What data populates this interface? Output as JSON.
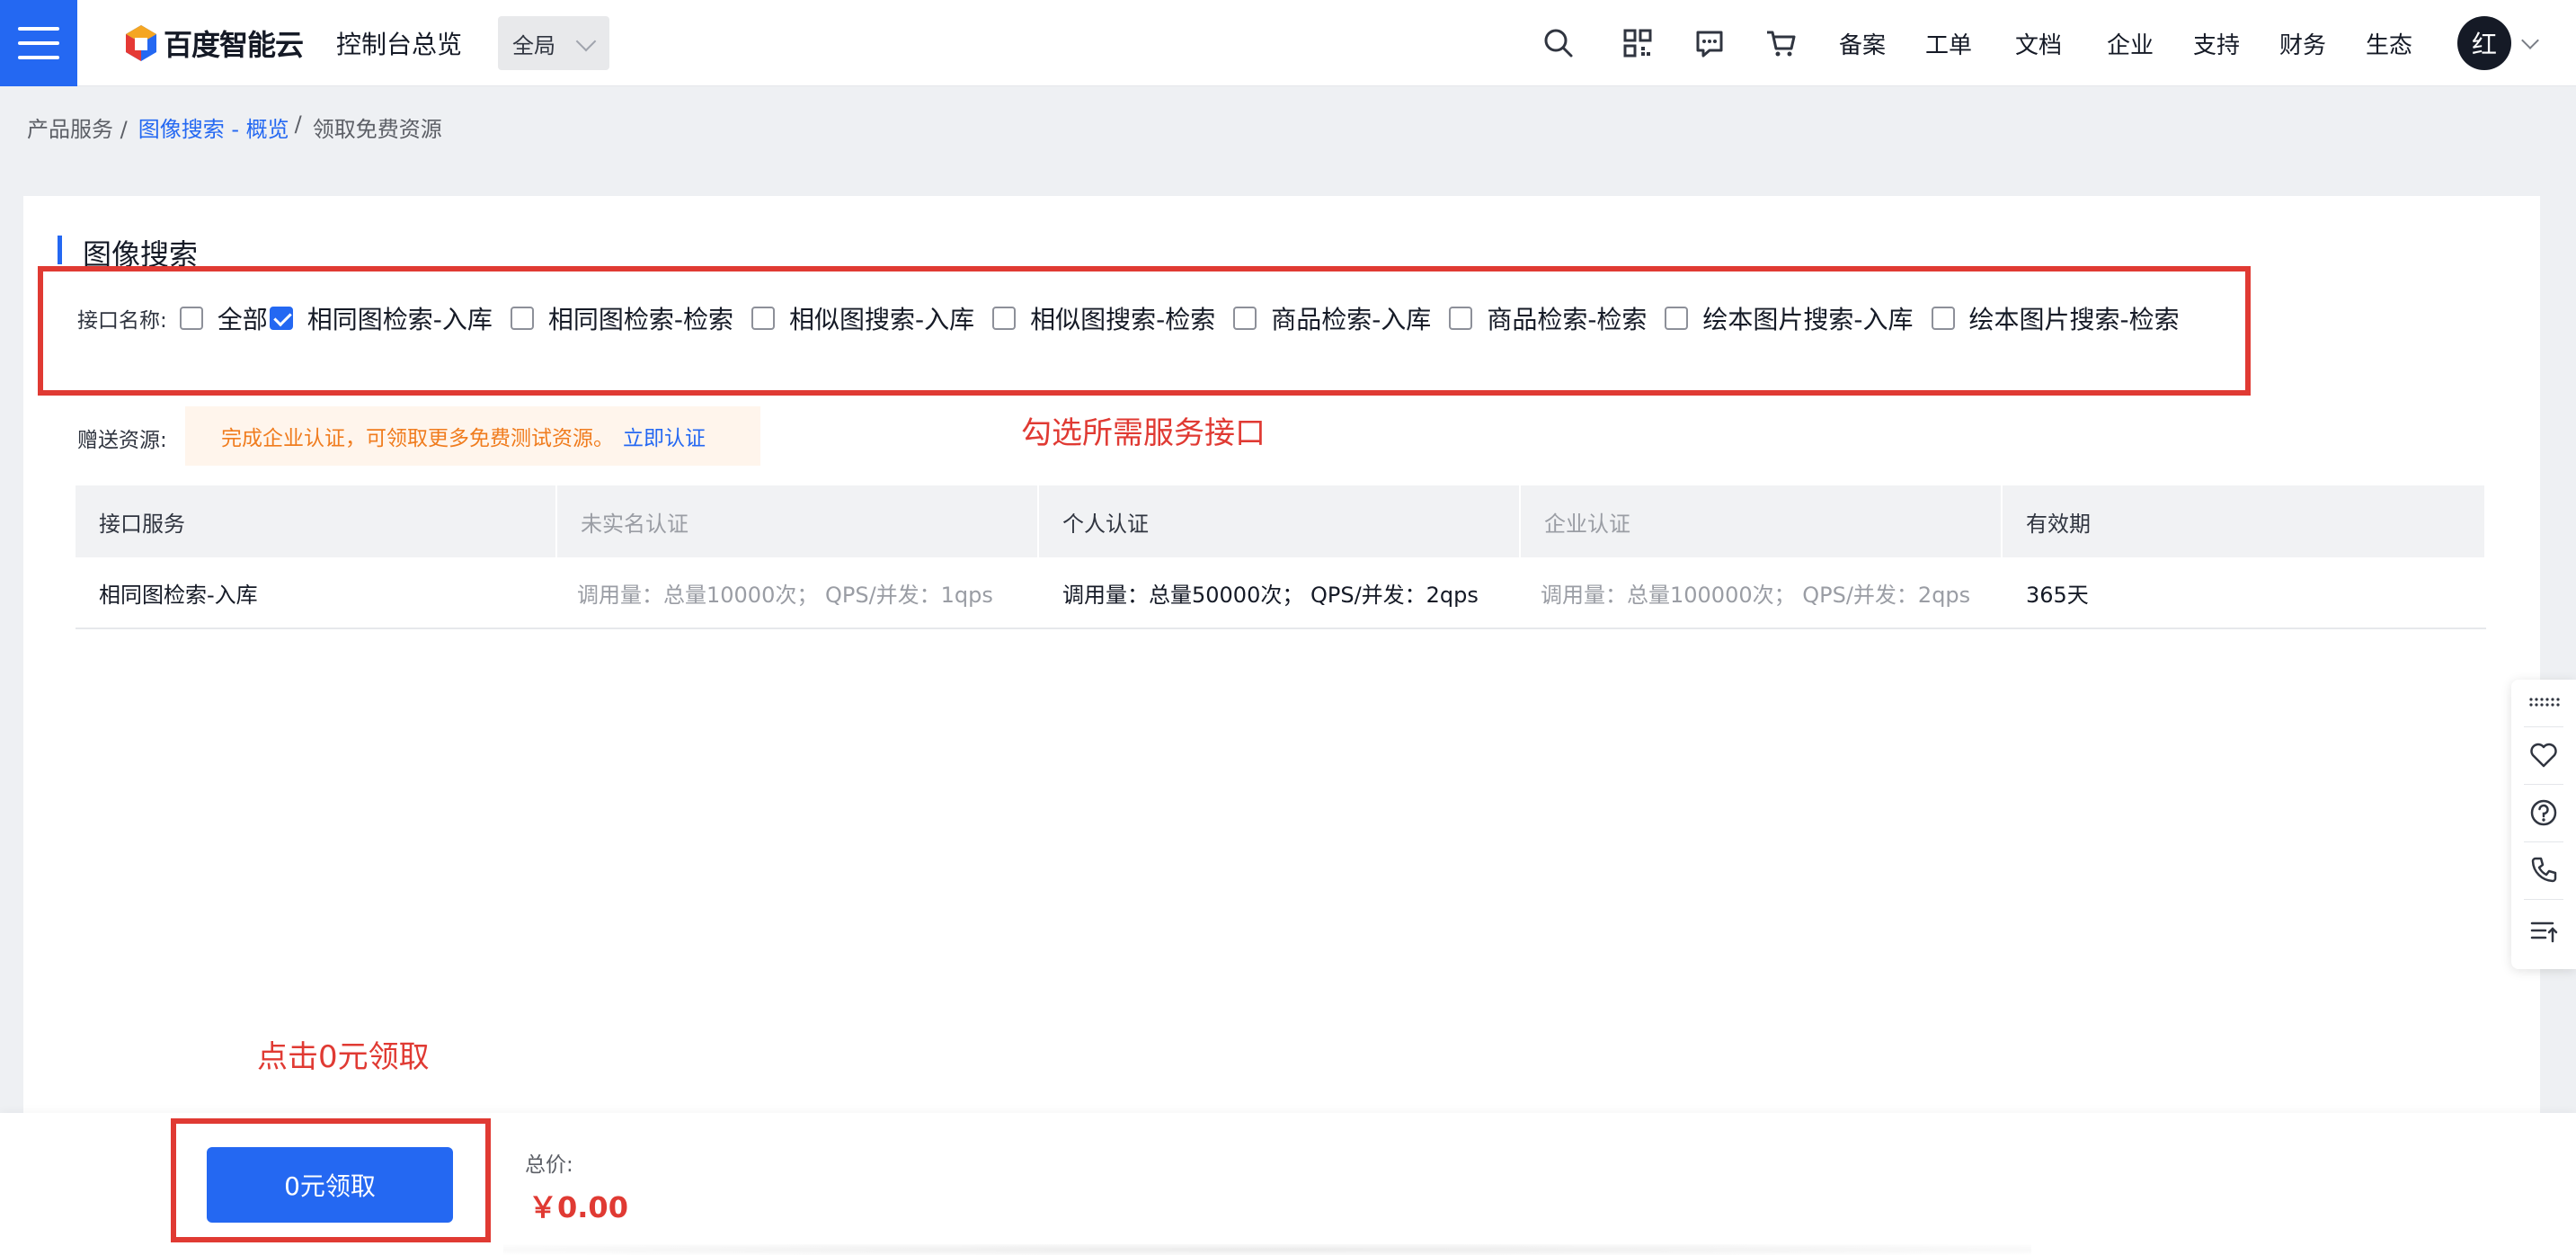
{
  "header": {
    "logo_text": "百度智能云",
    "console_title": "控制台总览",
    "scope": "全局",
    "nav": [
      "备案",
      "工单",
      "文档",
      "企业",
      "支持",
      "财务",
      "生态"
    ],
    "avatar_text": "红",
    "icons": [
      "search-icon",
      "qrcode-icon",
      "message-icon",
      "cart-icon"
    ]
  },
  "breadcrumb": {
    "item1": "产品服务 /",
    "item2": "图像搜索 - 概览",
    "sep2": "/",
    "item3": "领取免费资源"
  },
  "section": {
    "title": "图像搜索"
  },
  "interfaces": {
    "label": "接口名称:",
    "options": [
      {
        "label": "全部",
        "checked": false
      },
      {
        "label": "相同图检索-入库",
        "checked": true
      },
      {
        "label": "相同图检索-检索",
        "checked": false
      },
      {
        "label": "相似图搜索-入库",
        "checked": false
      },
      {
        "label": "相似图搜索-检索",
        "checked": false
      },
      {
        "label": "商品检索-入库",
        "checked": false
      },
      {
        "label": "商品检索-检索",
        "checked": false
      },
      {
        "label": "绘本图片搜索-入库",
        "checked": false
      },
      {
        "label": "绘本图片搜索-检索",
        "checked": false
      }
    ]
  },
  "annotations": {
    "select_hint": "勾选所需服务接口",
    "claim_hint": "点击0元领取",
    "color": "#e03a33"
  },
  "gift": {
    "label": "赠送资源:",
    "notice": "完成企业认证，可领取更多免费测试资源。",
    "link": "立即认证"
  },
  "table": {
    "headers": [
      "接口服务",
      "未实名认证",
      "个人认证",
      "企业认证",
      "有效期"
    ],
    "rows": [
      {
        "service": "相同图检索-入库",
        "unverified": "调用量：总量10000次； QPS/并发：1qps",
        "personal": "调用量：总量50000次； QPS/并发：2qps",
        "enterprise": "调用量：总量100000次； QPS/并发：2qps",
        "validity": "365天"
      }
    ]
  },
  "side_tools": [
    "drag-handle-icon",
    "heart-icon",
    "help-icon",
    "phone-icon",
    "list-up-icon"
  ],
  "footer": {
    "claim_button": "0元领取",
    "total_label": "总价:",
    "total_value": "￥0.00"
  },
  "colors": {
    "primary": "#2468f2",
    "accent_red": "#e03a33",
    "notice_orange": "#f07c1e"
  }
}
